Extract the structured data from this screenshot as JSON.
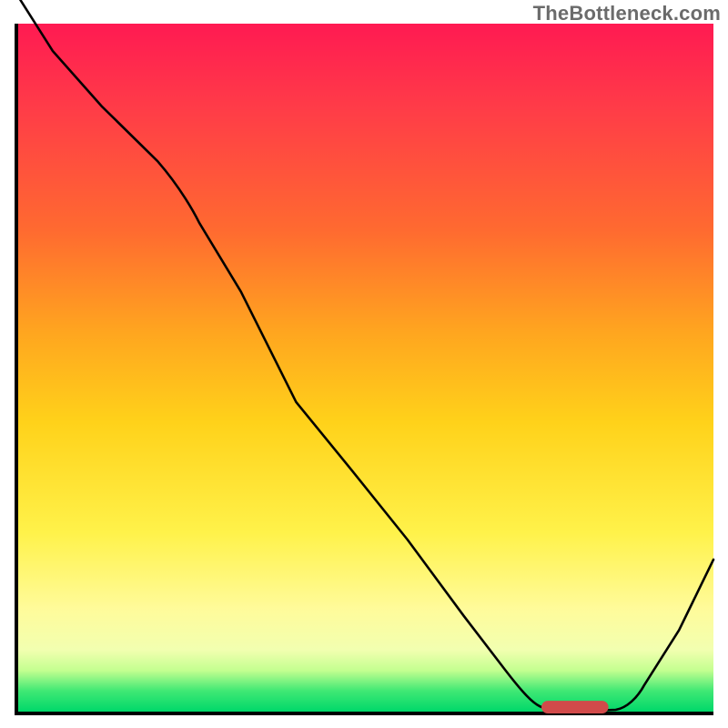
{
  "watermark": "TheBottleneck.com",
  "chart_data": {
    "type": "line",
    "title": "",
    "xlabel": "",
    "ylabel": "",
    "xlim": [
      0,
      100
    ],
    "ylim": [
      0,
      100
    ],
    "grid": false,
    "legend": false,
    "background_gradient": {
      "direction": "vertical",
      "stops": [
        {
          "pos": 0.0,
          "color": "#ff1a52"
        },
        {
          "pos": 0.3,
          "color": "#ff6a30"
        },
        {
          "pos": 0.58,
          "color": "#ffd21a"
        },
        {
          "pos": 0.85,
          "color": "#fffb9a"
        },
        {
          "pos": 0.97,
          "color": "#3fe874"
        },
        {
          "pos": 1.0,
          "color": "#00d86a"
        }
      ]
    },
    "series": [
      {
        "name": "bottleneck-curve",
        "x": [
          0,
          5,
          12,
          20,
          26,
          32,
          40,
          48,
          56,
          64,
          70,
          74,
          78,
          82,
          86,
          90,
          95,
          100
        ],
        "y": [
          104,
          96,
          88,
          80,
          74,
          67,
          56,
          45,
          34,
          23,
          14,
          7,
          2,
          0,
          0,
          4,
          12,
          22
        ]
      }
    ],
    "annotations": [
      {
        "name": "optimal-marker",
        "shape": "rounded-bar",
        "x_center": 80,
        "y": 0.5,
        "width_x": 8,
        "color": "#d14a4a"
      }
    ],
    "notes": "x and y are in axis-percentage units (0–100). Curve values at y>100 indicate the line extends above the top of the plot frame. The curve depicts a steep descent from upper-left reaching a minimum near x≈80–85 then rising toward the right edge."
  }
}
